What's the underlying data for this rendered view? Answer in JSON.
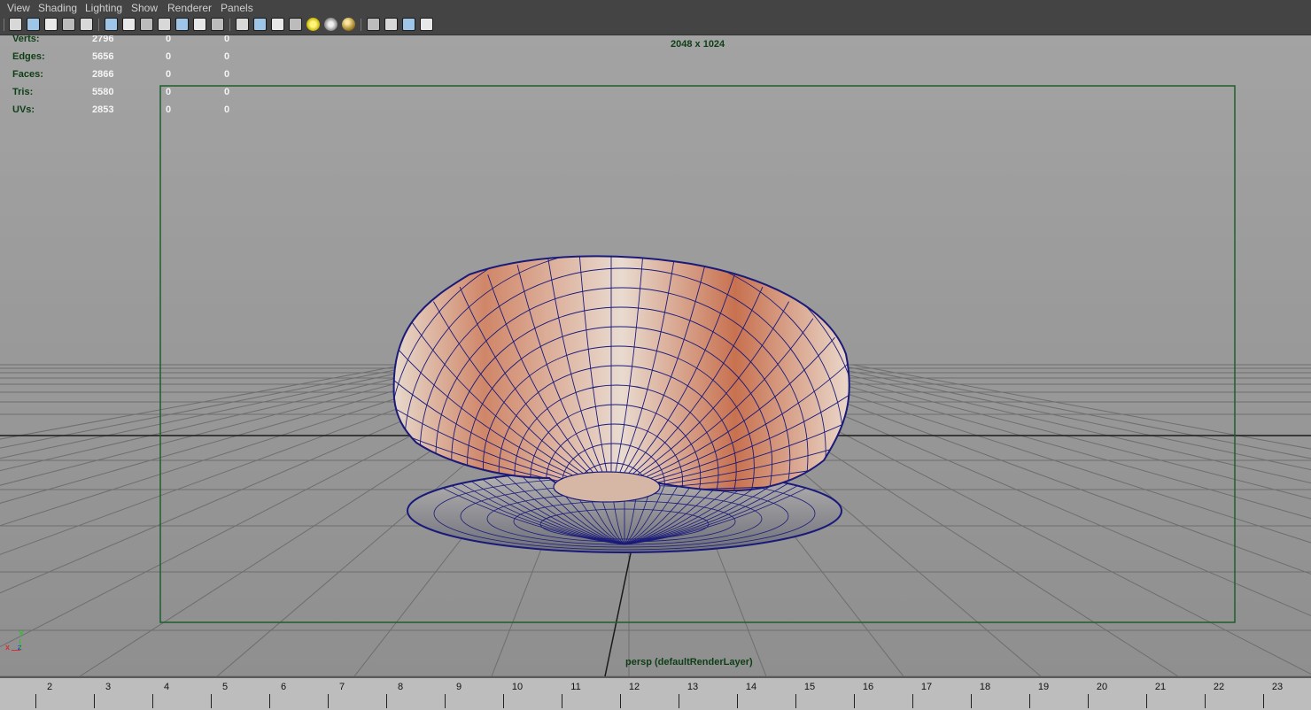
{
  "menu": [
    "View",
    "Shading",
    "Lighting",
    "Show",
    "Renderer",
    "Panels"
  ],
  "toolbar_icons": [
    "select-camera-icon",
    "camera-attributes-icon",
    "bookmarks-icon",
    "image-plane-icon",
    "2d-pan-zoom-icon",
    "grid-icon",
    "film-gate-icon",
    "resolution-gate-icon",
    "gate-mask-icon",
    "field-chart-icon",
    "safe-action-icon",
    "safe-title-icon",
    "wireframe-icon",
    "smooth-shade-icon",
    "wireframe-on-shaded-icon",
    "textured-icon",
    "default-lighting-icon",
    "all-lights-icon",
    "shadows-icon",
    "isolate-select-icon",
    "xray-icon",
    "xray-joints-icon",
    "backface-culling-icon"
  ],
  "hud": {
    "rows": [
      {
        "label": "Verts:",
        "value": "2796",
        "sel1": "0",
        "sel2": "0"
      },
      {
        "label": "Edges:",
        "value": "5656",
        "sel1": "0",
        "sel2": "0"
      },
      {
        "label": "Faces:",
        "value": "2866",
        "sel1": "0",
        "sel2": "0"
      },
      {
        "label": "Tris:",
        "value": "5580",
        "sel1": "0",
        "sel2": "0"
      },
      {
        "label": "UVs:",
        "value": "2853",
        "sel1": "0",
        "sel2": "0"
      }
    ]
  },
  "viewport": {
    "resolution": "2048 x 1024",
    "camera_label": "persp (defaultRenderLayer)",
    "axis": {
      "x": "x",
      "y": "Y",
      "z": "z"
    }
  },
  "timeline": {
    "ticks": [
      "2",
      "3",
      "4",
      "5",
      "6",
      "7",
      "8",
      "9",
      "10",
      "11",
      "12",
      "13",
      "14",
      "15",
      "16",
      "17",
      "18",
      "19",
      "20",
      "21",
      "22",
      "23"
    ]
  },
  "colors": {
    "hud_label": "#0d3f16",
    "hud_value": "#f4f4f4",
    "gate": "#1d5e2c",
    "wire": "#1a1a7a",
    "shell_light": "#e8d3c3",
    "shell_stripe": "#c56a48"
  }
}
